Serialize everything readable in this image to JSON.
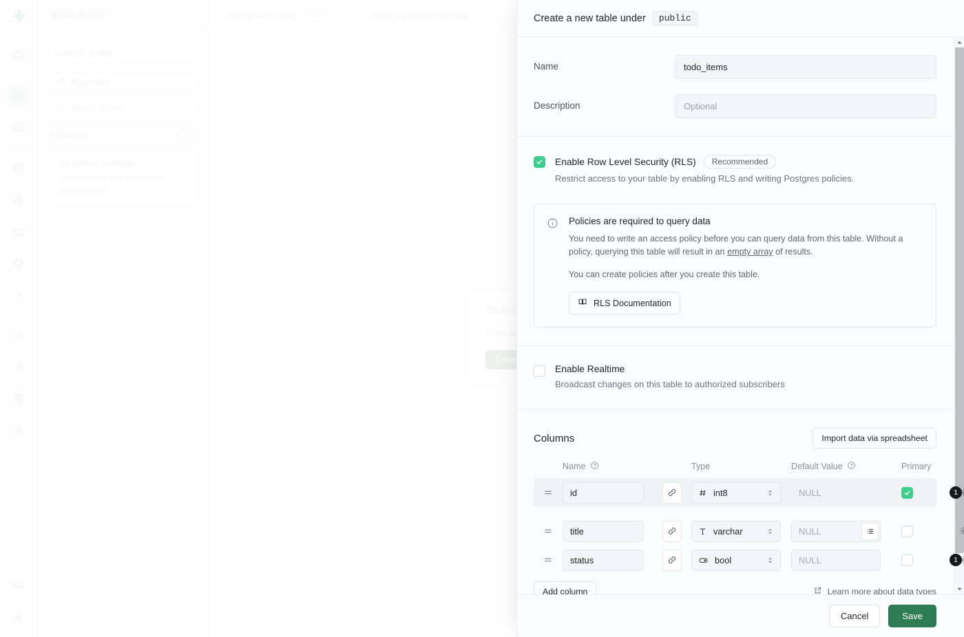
{
  "app": {
    "sidebar_title": "Table Editor"
  },
  "rail": {
    "items": [
      {
        "name": "supabase-logo-icon",
        "label": "Supabase"
      },
      {
        "name": "home-icon",
        "label": "Home"
      },
      {
        "name": "table-editor-icon",
        "label": "Table Editor"
      },
      {
        "name": "sql-editor-icon",
        "label": "SQL Editor"
      },
      {
        "name": "database-icon",
        "label": "Database"
      },
      {
        "name": "auth-icon",
        "label": "Authentication"
      },
      {
        "name": "storage-icon",
        "label": "Storage"
      },
      {
        "name": "integrations-icon",
        "label": "Integrations"
      },
      {
        "name": "edge-functions-icon",
        "label": "Edge Functions"
      },
      {
        "name": "reports-icon",
        "label": "Reports"
      },
      {
        "name": "logs-icon",
        "label": "Logs"
      },
      {
        "name": "docs-icon",
        "label": "API Docs"
      },
      {
        "name": "settings-icon",
        "label": "Project Settings"
      },
      {
        "name": "search-icon",
        "label": "Search"
      },
      {
        "name": "account-icon",
        "label": "Account"
      }
    ]
  },
  "breadcrumb": {
    "org": "yamap-web's Org",
    "plan_badge": "Free",
    "project": "react-supabase-todo-app",
    "separator": "/"
  },
  "sidebar": {
    "schema_label": "schema",
    "schema_value": "public",
    "new_table_label": "New table",
    "search_placeholder": "Search tables",
    "tables_heading": "Tables (0)",
    "empty_title": "No entities available",
    "empty_desc": "This schema has no entities available yet"
  },
  "background_card": {
    "title": "Table E",
    "desc": "There ar",
    "button": "Create "
  },
  "panel": {
    "title": "Create a new table under",
    "schema_chip": "public",
    "name_label": "Name",
    "name_value": "todo_items",
    "description_label": "Description",
    "description_placeholder": "Optional",
    "rls": {
      "checked": true,
      "title": "Enable Row Level Security (RLS)",
      "badge": "Recommended",
      "desc": "Restrict access to your table by enabling RLS and writing Postgres policies."
    },
    "callout": {
      "title": "Policies are required to query data",
      "p1_a": "You need to write an access policy before you can query data from this table. Without a policy, querying this table will result in an ",
      "p1_link": "empty array",
      "p1_b": " of results.",
      "p2": "You can create policies after you create this table.",
      "doc_button": "RLS Documentation"
    },
    "realtime": {
      "checked": false,
      "title": "Enable Realtime",
      "desc": "Broadcast changes on this table to authorized subscribers"
    },
    "columns": {
      "heading": "Columns",
      "import_button": "Import data via spreadsheet",
      "headers": {
        "name": "Name",
        "type": "Type",
        "default": "Default Value",
        "primary": "Primary"
      },
      "rows": [
        {
          "name": "id",
          "type": "int8",
          "type_icon": "hash-icon",
          "default_placeholder": "NULL",
          "default_value": "",
          "primary": true,
          "has_list_button": false,
          "badge_count": "1",
          "highlighted": true
        },
        {
          "name": "title",
          "type": "varchar",
          "type_icon": "text-icon",
          "default_placeholder": "NULL",
          "default_value": "",
          "primary": false,
          "has_list_button": true,
          "badge_count": "",
          "highlighted": false
        },
        {
          "name": "status",
          "type": "bool",
          "type_icon": "toggle-icon",
          "default_placeholder": "NULL",
          "default_value": "",
          "primary": false,
          "has_list_button": false,
          "badge_count": "1",
          "highlighted": false
        }
      ],
      "add_column_button": "Add column",
      "learn_more": "Learn more about data types"
    },
    "cancel_button": "Cancel",
    "save_button": "Save"
  },
  "colors": {
    "accent_green": "#3ECF8E",
    "save_green": "#2E7D52",
    "badge_black": "#15191E"
  }
}
